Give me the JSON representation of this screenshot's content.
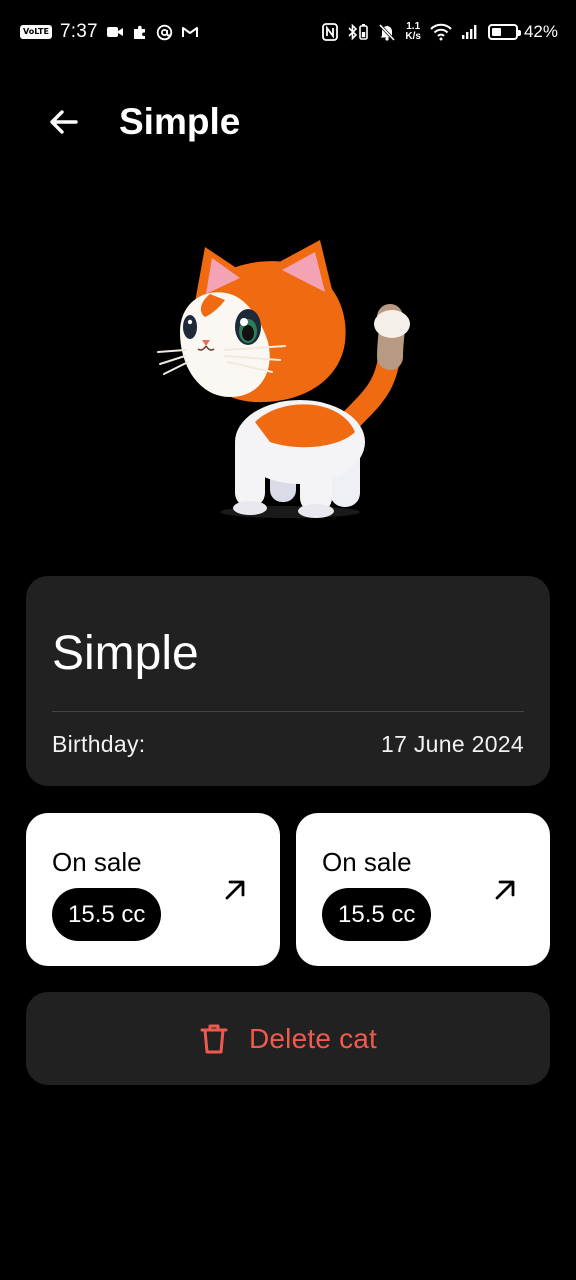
{
  "status_bar": {
    "network_badge": "VoLTE",
    "time": "7:37",
    "net_speed_value": "1.1",
    "net_speed_unit": "K/s",
    "battery_percent_text": "42%",
    "battery_level": 0.42
  },
  "header": {
    "title": "Simple",
    "back_icon": "arrow-left-icon"
  },
  "cat": {
    "image_icon": "orange-white-cat-illustration",
    "name": "Simple",
    "birthday_label": "Birthday:",
    "birthday_value": "17 June 2024"
  },
  "sales": [
    {
      "label": "On sale",
      "price": "15.5 cc",
      "icon": "arrow-up-right-icon"
    },
    {
      "label": "On sale",
      "price": "15.5 cc",
      "icon": "arrow-up-right-icon"
    }
  ],
  "delete_button": {
    "label": "Delete cat",
    "icon": "trash-icon",
    "color": "#ef5a4e"
  },
  "colors": {
    "background": "#000000",
    "card_dark": "#212121",
    "card_light": "#ffffff",
    "cat_orange": "#f06a12"
  }
}
